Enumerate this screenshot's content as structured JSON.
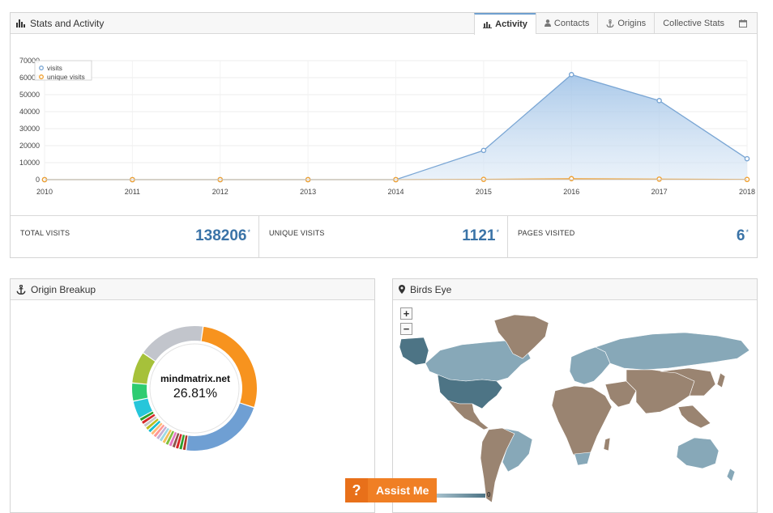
{
  "stats_panel": {
    "title": "Stats and Activity",
    "tabs": [
      {
        "label": "Activity",
        "icon": "bar-chart-icon",
        "active": true
      },
      {
        "label": "Contacts",
        "icon": "user-icon",
        "active": false
      },
      {
        "label": "Origins",
        "icon": "anchor-icon",
        "active": false
      },
      {
        "label": "Collective Stats",
        "icon": "calendar-icon",
        "active": false
      }
    ]
  },
  "chart_data": {
    "type": "area",
    "x": [
      "2010",
      "2011",
      "2012",
      "2013",
      "2014",
      "2015",
      "2016",
      "2017",
      "2018"
    ],
    "y_ticks": [
      "0",
      "10000",
      "20000",
      "30000",
      "40000",
      "50000",
      "60000",
      "70000"
    ],
    "ylim": [
      0,
      70000
    ],
    "grid": true,
    "legend_placement": "top-left",
    "series": [
      {
        "name": "visits",
        "color": "#7aa6d4",
        "values": [
          0,
          0,
          0,
          0,
          0,
          17200,
          61800,
          46500,
          12300
        ]
      },
      {
        "name": "unique visits",
        "color": "#f0a030",
        "values": [
          0,
          0,
          0,
          0,
          0,
          150,
          550,
          300,
          100
        ]
      }
    ]
  },
  "totals": [
    {
      "label": "TOTAL VISITS",
      "value": "138206",
      "mark": "*"
    },
    {
      "label": "UNIQUE VISITS",
      "value": "1121",
      "mark": "*"
    },
    {
      "label": "PAGES VISITED",
      "value": "6",
      "mark": "*"
    }
  ],
  "origin_panel": {
    "title": "Origin Breakup",
    "center_label": "mindmatrix.net",
    "center_value": "26.81%",
    "donut_segments": [
      {
        "color": "#f7931e",
        "percent": 26.81
      },
      {
        "color": "#6f9fd3",
        "percent": 21.5
      },
      {
        "color": "#b23a2a",
        "percent": 0.9
      },
      {
        "color": "#2ca02c",
        "percent": 0.9
      },
      {
        "color": "#d62728",
        "percent": 0.9
      },
      {
        "color": "#8c564b",
        "percent": 0.9
      },
      {
        "color": "#e377c2",
        "percent": 0.9
      },
      {
        "color": "#7fbf3f",
        "percent": 0.9
      },
      {
        "color": "#f2c05c",
        "percent": 0.9
      },
      {
        "color": "#9edae5",
        "percent": 0.9
      },
      {
        "color": "#c5b0d5",
        "percent": 0.9
      },
      {
        "color": "#ff9896",
        "percent": 0.9
      },
      {
        "color": "#ffbb78",
        "percent": 0.9
      },
      {
        "color": "#17becf",
        "percent": 0.9
      },
      {
        "color": "#bcbd22",
        "percent": 0.9
      },
      {
        "color": "#c7c7c7",
        "percent": 0.9
      },
      {
        "color": "#d62728",
        "percent": 0.9
      },
      {
        "color": "#2ca02c",
        "percent": 0.9
      },
      {
        "color": "#26c6da",
        "percent": 4.5
      },
      {
        "color": "#2ecc71",
        "percent": 4.5
      },
      {
        "color": "#a6c13a",
        "percent": 8.0
      },
      {
        "color": "#c2c5cc",
        "percent": 17.0
      }
    ]
  },
  "map_panel": {
    "title": "Birds Eye",
    "zoom_in": "+",
    "zoom_out": "−",
    "legend_value": "0",
    "colors": {
      "ocean": "#ffffff",
      "no_data": "#9a8471",
      "low": "#87a8b8",
      "high": "#4d7485"
    }
  },
  "assist": {
    "icon": "?",
    "label": "Assist Me"
  }
}
